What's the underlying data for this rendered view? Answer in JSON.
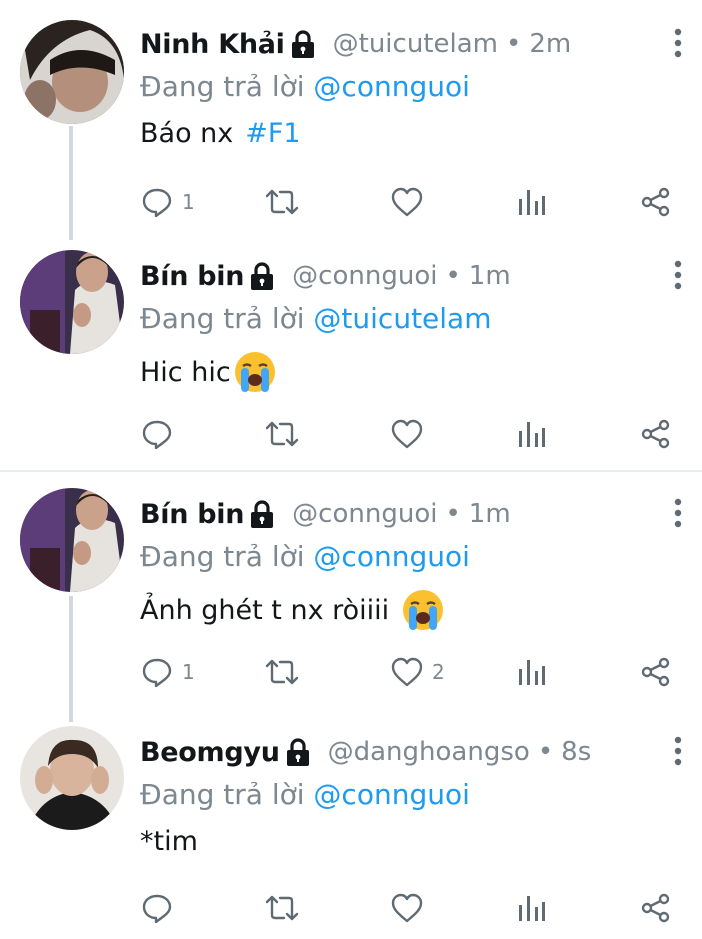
{
  "tweets": [
    {
      "name": "Ninh Khải",
      "handle": "@tuicutelam",
      "sep": "•",
      "time": "2m",
      "replying_prefix": "Đang trả lời ",
      "replying_to": "@connguoi",
      "text": "Báo nx",
      "hashtag": "#F1",
      "reply_count": "1",
      "like_count": ""
    },
    {
      "name": "Bín bin",
      "handle": "@connguoi",
      "sep": "•",
      "time": "1m",
      "replying_prefix": "Đang trả lời ",
      "replying_to": "@tuicutelam",
      "text": "Hic hic",
      "reply_count": "",
      "like_count": ""
    },
    {
      "name": "Bín bin",
      "handle": "@connguoi",
      "sep": "•",
      "time": "1m",
      "replying_prefix": "Đang trả lời ",
      "replying_to": "@connguoi",
      "text": "Ảnh ghét t nx ròiiii",
      "reply_count": "1",
      "like_count": "2"
    },
    {
      "name": "Beomgyu",
      "handle": "@danghoangso",
      "sep": "•",
      "time": "8s",
      "replying_prefix": "Đang trả lời ",
      "replying_to": "@connguoi",
      "text": "*tim",
      "reply_count": "",
      "like_count": ""
    }
  ],
  "icons": {
    "lock": "lock-icon",
    "reply": "reply-icon",
    "retweet": "retweet-icon",
    "like": "heart-icon",
    "analytics": "analytics-icon",
    "share": "share-icon",
    "more": "more-vertical-icon",
    "emoji": "crying-face-emoji"
  },
  "colors": {
    "mention": "#1d9bf0",
    "muted": "#7c8790",
    "text": "#14171a",
    "thread_line": "#d2d7dc"
  }
}
